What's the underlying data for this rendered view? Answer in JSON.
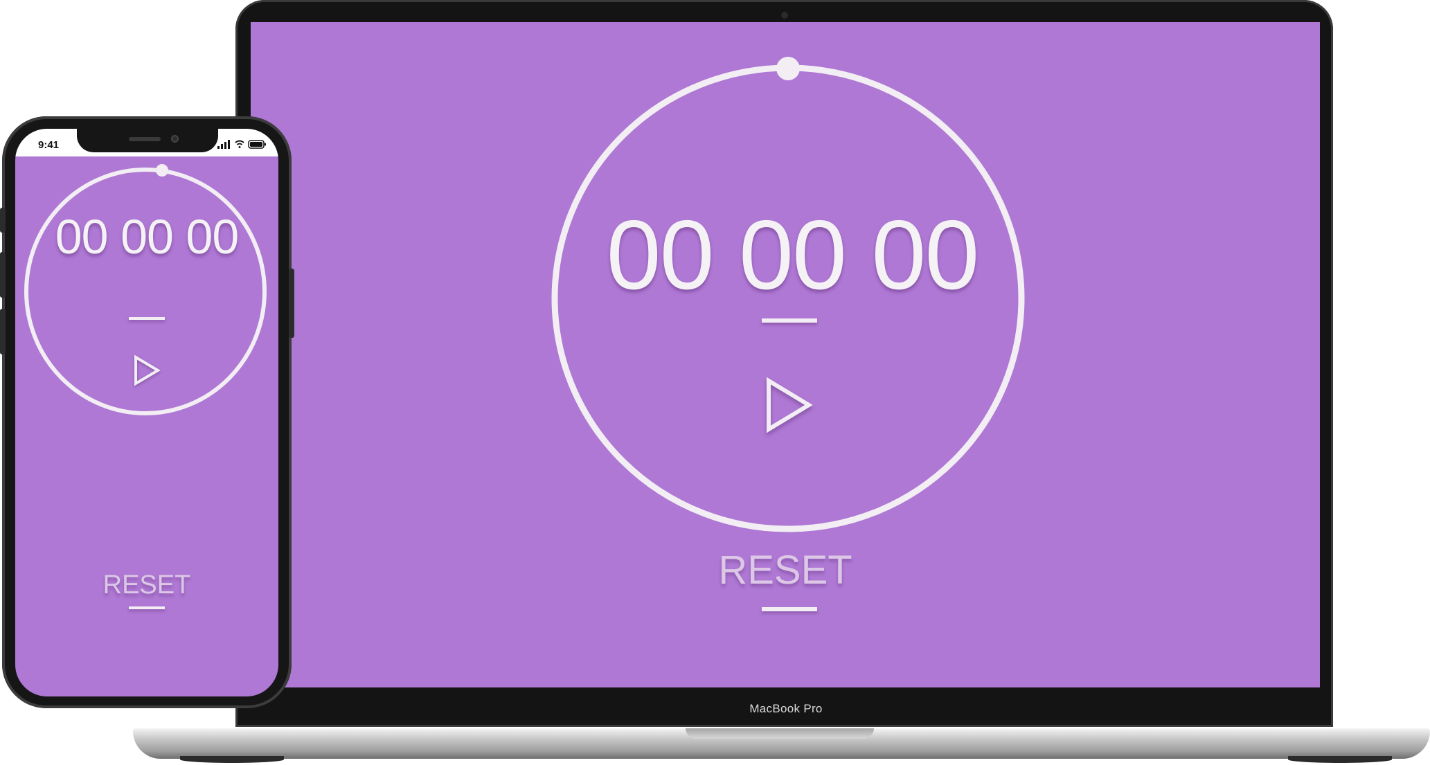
{
  "theme": {
    "accent": "#ae78d4",
    "foreground": "#f5f2f6"
  },
  "laptop": {
    "brand_label": "MacBook Pro",
    "timer": {
      "hours": "00",
      "minutes": "00",
      "seconds": "00"
    },
    "reset_label": "RESET",
    "play_icon": "play-icon"
  },
  "phone": {
    "status_time": "9:41",
    "status_icons": [
      "signal-icon",
      "wifi-icon",
      "battery-icon"
    ],
    "timer": {
      "hours": "00",
      "minutes": "00",
      "seconds": "00"
    },
    "reset_label": "RESET",
    "play_icon": "play-icon"
  }
}
